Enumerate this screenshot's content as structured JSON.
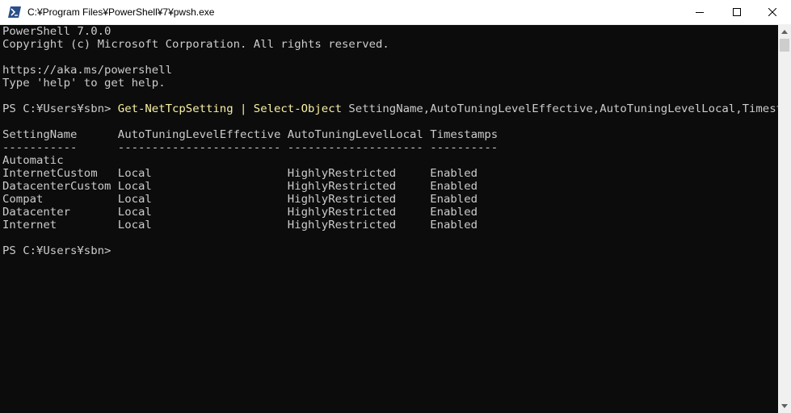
{
  "window": {
    "title": "C:¥Program Files¥PowerShell¥7¥pwsh.exe"
  },
  "console": {
    "banner_line1": "PowerShell 7.0.0",
    "banner_line2": "Copyright (c) Microsoft Corporation. All rights reserved.",
    "link_line": "https://aka.ms/powershell",
    "help_line": "Type 'help' to get help.",
    "prompt": "PS C:¥Users¥sbn> ",
    "command": "Get-NetTcpSetting | Select-Object",
    "command_args": " SettingName,AutoTuningLevelEffective,AutoTuningLevelLocal,Timestamps",
    "table_header": "SettingName      AutoTuningLevelEffective AutoTuningLevelLocal Timestamps",
    "table_separator": "-----------      ------------------------ -------------------- ----------",
    "rows": [
      "Automatic",
      "InternetCustom   Local                    HighlyRestricted     Enabled",
      "DatacenterCustom Local                    HighlyRestricted     Enabled",
      "Compat           Local                    HighlyRestricted     Enabled",
      "Datacenter       Local                    HighlyRestricted     Enabled",
      "Internet         Local                    HighlyRestricted     Enabled"
    ],
    "final_prompt": "PS C:¥Users¥sbn>"
  },
  "colors": {
    "console_bg": "#0c0c0c",
    "console_text": "#cccccc",
    "command_text": "#f9f1a5"
  },
  "icons": [
    "powershell-icon",
    "minimize-icon",
    "maximize-icon",
    "close-icon",
    "scroll-up-icon",
    "scroll-down-icon"
  ]
}
